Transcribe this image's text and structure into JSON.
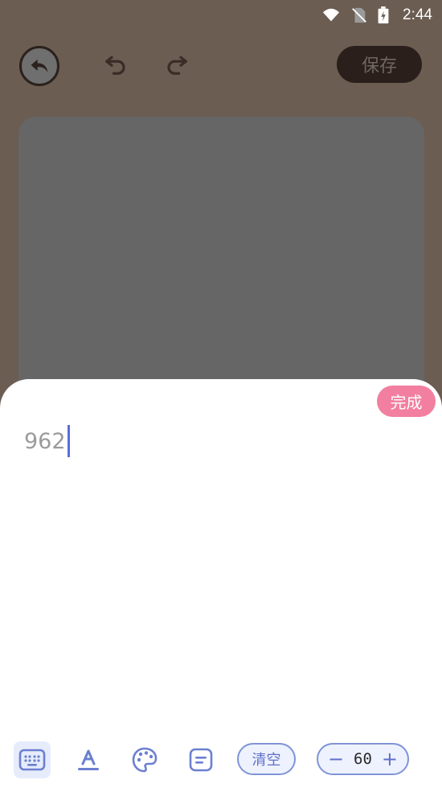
{
  "status_bar": {
    "time": "2:44",
    "icons": [
      "wifi-icon",
      "no-sim-icon",
      "battery-charging-icon"
    ]
  },
  "toolbar": {
    "back_icon": "back-arrow-icon",
    "undo_icon": "undo-icon",
    "redo_icon": "redo-icon",
    "save_label": "保存"
  },
  "sheet": {
    "done_label": "完成",
    "text_value": "962"
  },
  "tools": {
    "items": [
      "keyboard-icon",
      "font-color-icon",
      "palette-icon",
      "align-text-icon"
    ],
    "clear_label": "清空",
    "size_value": "60",
    "decrement_label": "−",
    "increment_label": "+"
  },
  "colors": {
    "overlay_background": "#6b5d52",
    "canvas_card": "#666666",
    "accent_pink": "#f27fa0",
    "accent_blue": "#7f93d7",
    "caret": "#5a6fd6"
  }
}
